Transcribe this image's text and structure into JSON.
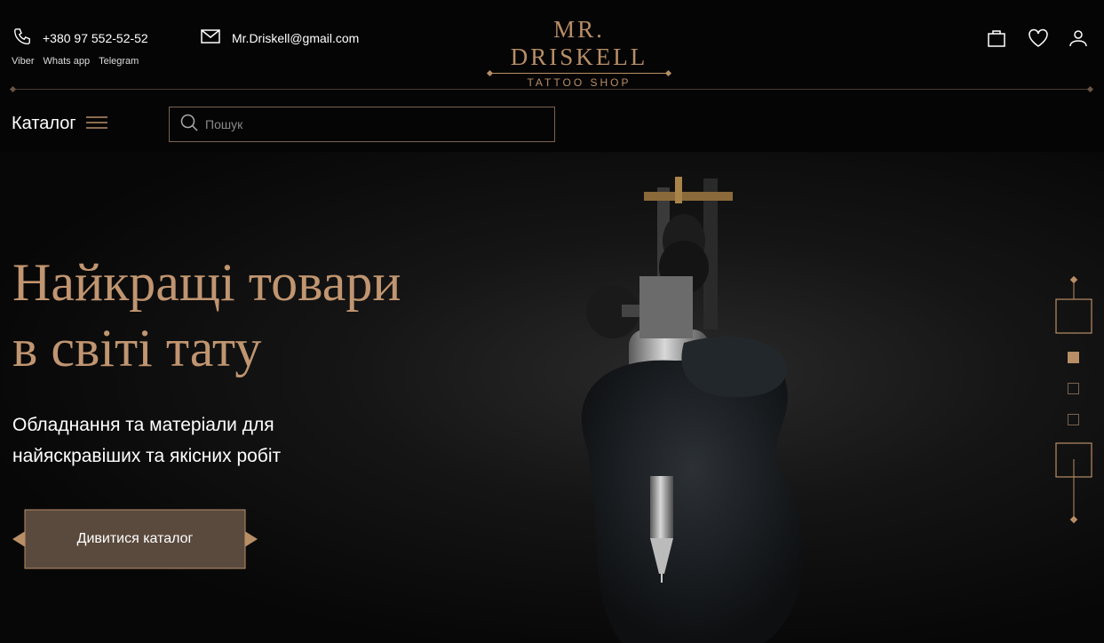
{
  "header": {
    "phone": "+380 97 552-52-52",
    "messengers": [
      "Viber",
      "Whats app",
      "Telegram"
    ],
    "email": "Mr.Driskell@gmail.com",
    "logo_name": "MR. DRISKELL",
    "logo_sub": "TATTOO SHOP",
    "icons": [
      "cart-icon",
      "heart-icon",
      "user-icon"
    ]
  },
  "nav": {
    "catalog_label": "Каталог",
    "search_placeholder": "Пошук"
  },
  "hero": {
    "title_line1": "Найкращі товари",
    "title_line2": "в світі тату",
    "subtitle_line1": "Обладнання та матеріали для",
    "subtitle_line2": "найяскравіших та якісних робіт",
    "cta_label": "Дивитися каталог"
  },
  "slider": {
    "total": 3,
    "active_index": 0
  },
  "colors": {
    "accent": "#b88e66",
    "background": "#050505",
    "button": "#5a4a3d"
  }
}
